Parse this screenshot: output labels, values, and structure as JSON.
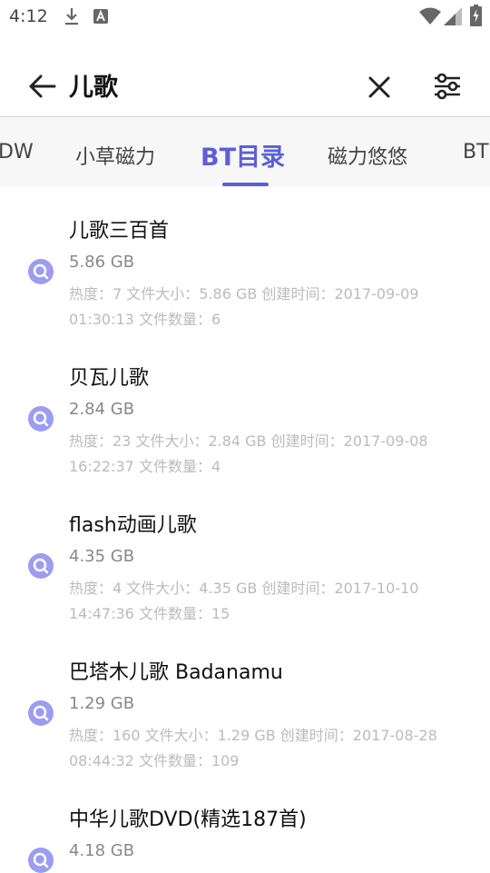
{
  "status_bar": {
    "time": "4:12",
    "icons": [
      "download-icon",
      "a-icon",
      "wifi-icon",
      "signal-icon",
      "battery-icon"
    ]
  },
  "search": {
    "query": "儿歌",
    "back_icon": "arrow-left-icon",
    "clear_icon": "close-icon",
    "filter_icon": "tune-icon"
  },
  "tabs": {
    "items": [
      {
        "label": "DW"
      },
      {
        "label": "小草磁力"
      },
      {
        "label": "BT目录"
      },
      {
        "label": "磁力悠悠"
      },
      {
        "label": "BT"
      }
    ],
    "active_index": 2
  },
  "colors": {
    "accent": "#5c5fd6",
    "icon": "#9c9cf0",
    "meta": "#bbbbbb"
  },
  "results": [
    {
      "title": "儿歌三百首",
      "size": "5.86 GB",
      "meta": "热度：7 文件大小：5.86 GB 创建时间：2017-09-09 01:30:13 文件数量：6"
    },
    {
      "title": "贝瓦儿歌",
      "size": "2.84 GB",
      "meta": "热度：23 文件大小：2.84 GB 创建时间：2017-09-08 16:22:37 文件数量：4"
    },
    {
      "title": "flash动画儿歌",
      "size": "4.35 GB",
      "meta": "热度：4 文件大小：4.35 GB 创建时间：2017-10-10 14:47:36 文件数量：15"
    },
    {
      "title": "巴塔木儿歌 Badanamu",
      "size": "1.29 GB",
      "meta": "热度：160 文件大小：1.29 GB 创建时间：2017-08-28 08:44:32 文件数量：109"
    },
    {
      "title": "中华儿歌DVD(精选187首)",
      "size": "4.18 GB",
      "meta": ""
    }
  ]
}
